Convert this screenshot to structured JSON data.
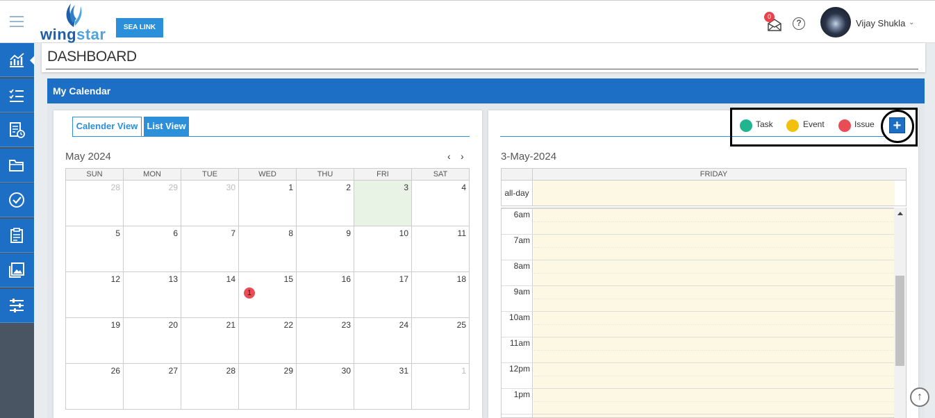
{
  "brand": {
    "logo_text_a": "wing",
    "logo_text_b": "star",
    "vessel_button": "SEA LINK"
  },
  "header": {
    "mail_count": "0",
    "help_glyph": "?",
    "user_name": "Vijay Shukla",
    "caret": "⌄"
  },
  "page": {
    "title": "DASHBOARD",
    "section_title": "My Calendar"
  },
  "calendar": {
    "tabs": {
      "calendar_view": "Calender View",
      "list_view": "List View"
    },
    "month_title": "May 2024",
    "nav_prev": "‹",
    "nav_next": "›",
    "weekdays": [
      "SUN",
      "MON",
      "TUE",
      "WED",
      "THU",
      "FRI",
      "SAT"
    ],
    "weeks": [
      [
        "28",
        "29",
        "30",
        "1",
        "2",
        "3",
        "4"
      ],
      [
        "5",
        "6",
        "7",
        "8",
        "9",
        "10",
        "11"
      ],
      [
        "12",
        "13",
        "14",
        "15",
        "16",
        "17",
        "18"
      ],
      [
        "19",
        "20",
        "21",
        "22",
        "23",
        "24",
        "25"
      ],
      [
        "26",
        "27",
        "28",
        "29",
        "30",
        "31",
        "1"
      ]
    ],
    "event_badge": "1"
  },
  "day_view": {
    "date_title": "3-May-2024",
    "day_name": "FRIDAY",
    "allday_label": "all-day",
    "times": [
      "6am",
      "7am",
      "8am",
      "9am",
      "10am",
      "11am",
      "12pm",
      "1pm"
    ]
  },
  "legend": {
    "task": "Task",
    "event": "Event",
    "issue": "Issue",
    "task_color": "#20b58e",
    "event_color": "#f2c10f",
    "issue_color": "#ea4c56",
    "add_glyph": "+"
  },
  "scroll_top_glyph": "↑"
}
